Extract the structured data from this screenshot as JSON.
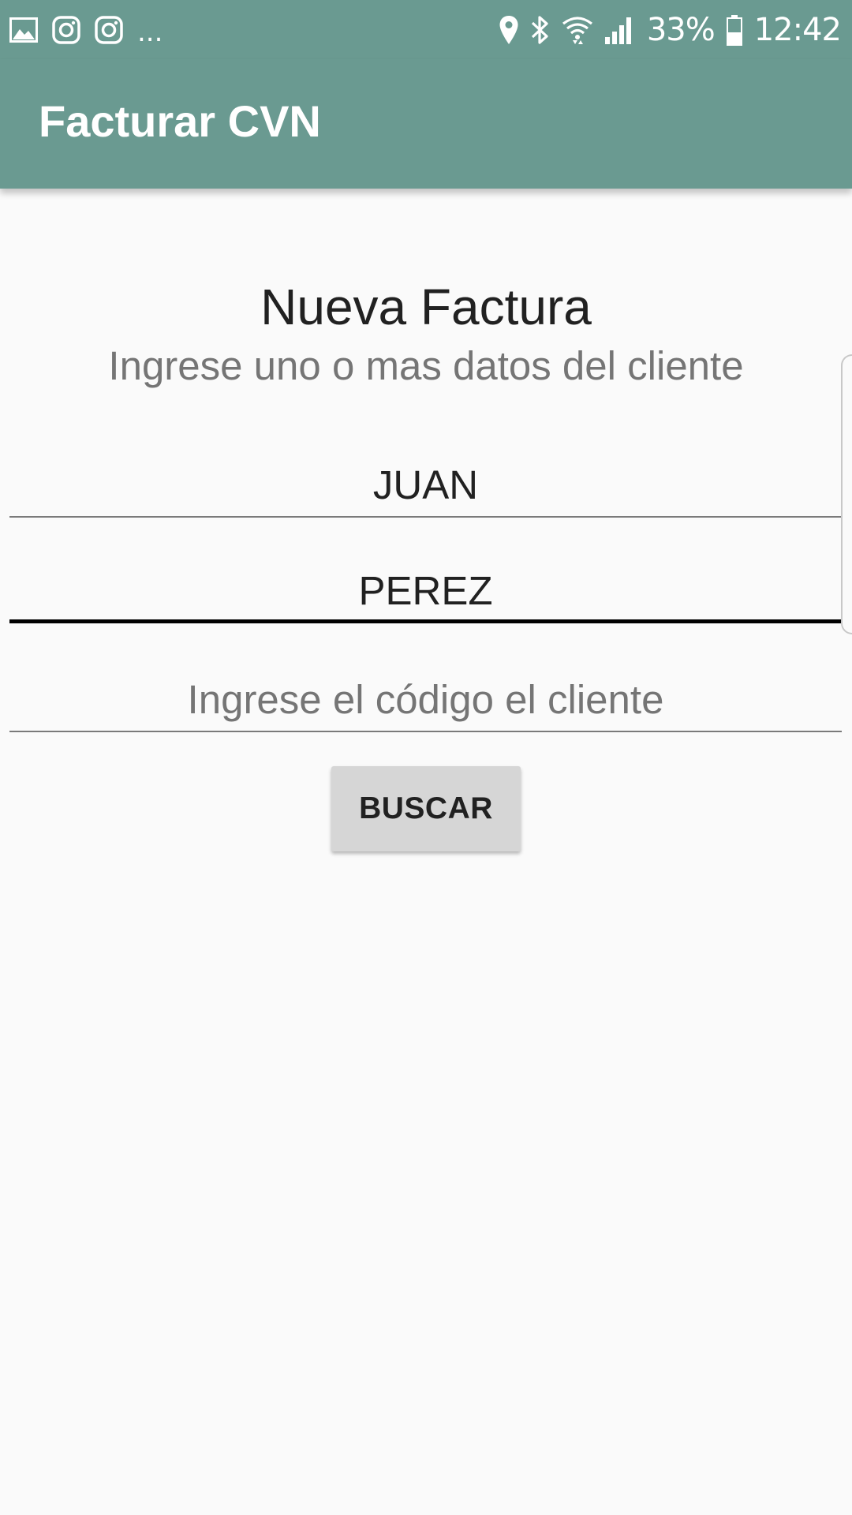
{
  "status_bar": {
    "left_icons": [
      "image-icon",
      "instagram-icon",
      "instagram-icon"
    ],
    "overflow_dots": "...",
    "right_icons": [
      "location-pin-icon",
      "bluetooth-icon",
      "wifi-icon",
      "cellular-signal-icon",
      "battery-icon"
    ],
    "battery_percent": "33%",
    "time": "12:42"
  },
  "app_bar": {
    "title": "Facturar CVN",
    "color": "#6a9a91"
  },
  "form": {
    "heading": "Nueva Factura",
    "subheading": "Ingrese uno o mas datos del cliente",
    "nombre_value": "JUAN",
    "apellido_value": "PEREZ",
    "codigo_value": "",
    "codigo_placeholder": "Ingrese el código el cliente",
    "search_button_label": "BUSCAR"
  },
  "colors": {
    "accent": "#6a9a91",
    "background": "#fafafa",
    "button": "#d6d6d6"
  }
}
